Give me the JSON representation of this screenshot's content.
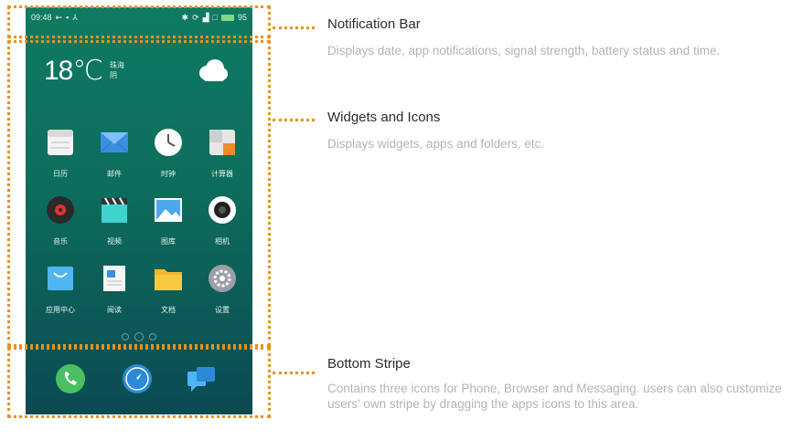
{
  "phone": {
    "status_left": "09:48",
    "status_right_value": "95",
    "weather": {
      "temp": "18℃",
      "city_line1": "珠海",
      "city_line2": "阴"
    },
    "apps": [
      {
        "label": "日历",
        "icon": "calendar-icon"
      },
      {
        "label": "邮件",
        "icon": "mail-icon"
      },
      {
        "label": "时钟",
        "icon": "clock-icon"
      },
      {
        "label": "计算器",
        "icon": "calculator-icon"
      },
      {
        "label": "音乐",
        "icon": "music-icon"
      },
      {
        "label": "视频",
        "icon": "video-icon"
      },
      {
        "label": "图库",
        "icon": "gallery-icon"
      },
      {
        "label": "相机",
        "icon": "camera-icon"
      },
      {
        "label": "应用中心",
        "icon": "app-center-icon"
      },
      {
        "label": "阅读",
        "icon": "reader-icon"
      },
      {
        "label": "文档",
        "icon": "folder-icon"
      },
      {
        "label": "设置",
        "icon": "settings-icon"
      }
    ],
    "dock": [
      "phone-icon",
      "browser-icon",
      "messaging-icon"
    ]
  },
  "annotations": [
    {
      "title": "Notification Bar",
      "desc": "Displays date, app notifications, signal strength, battery status and time."
    },
    {
      "title": "Widgets and Icons",
      "desc": "Displays widgets, apps and folders, etc."
    },
    {
      "title": "Bottom Stripe",
      "desc": "Contains three icons for Phone, Browser and Messaging. users can also customize users' own stripe by dragging the apps icons to this area."
    }
  ],
  "colors": {
    "accent": "#e8921c",
    "screen_top": "#0f7a62",
    "screen_bottom": "#0b4a53",
    "desc_text": "#b4b4b4"
  }
}
